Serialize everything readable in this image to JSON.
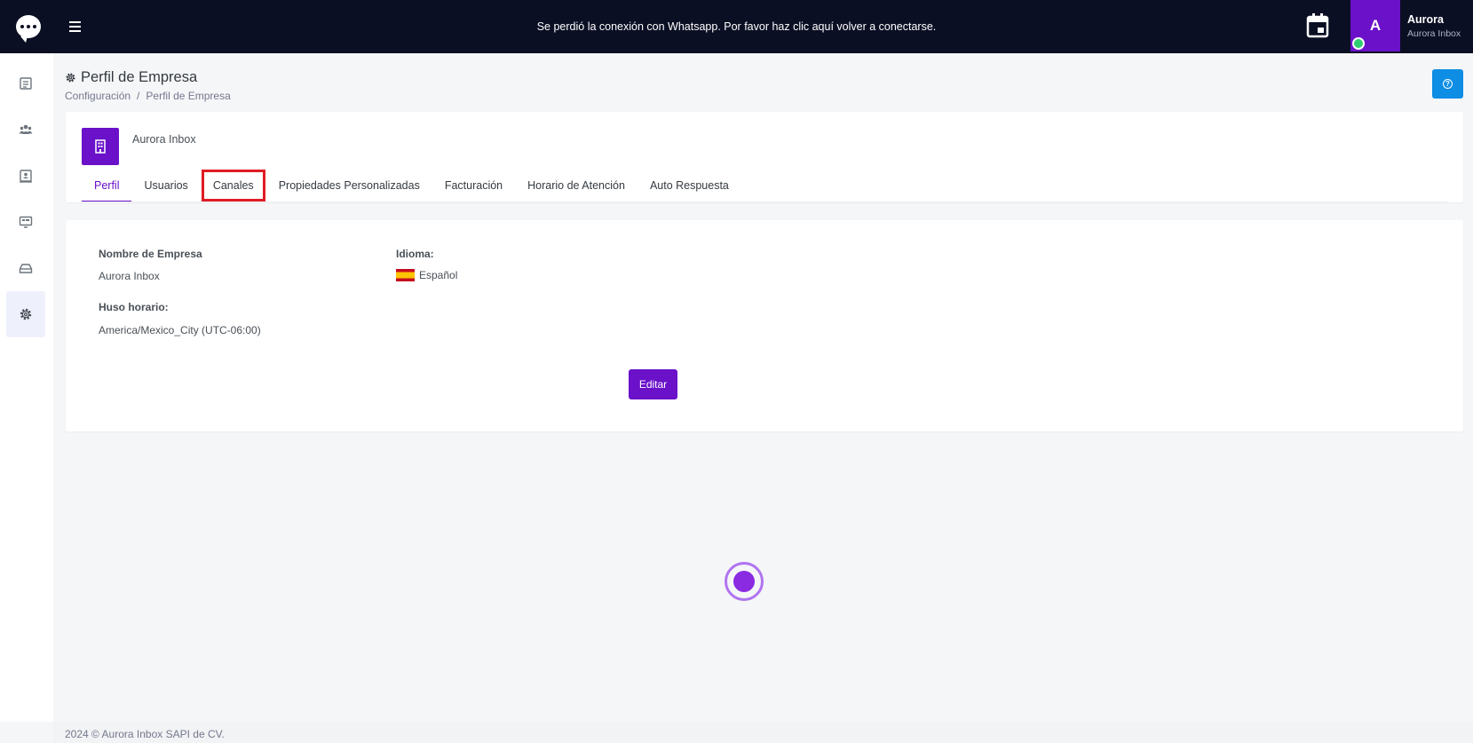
{
  "topbar": {
    "connection_message": "Se perdió la conexión con Whatsapp. Por favor haz clic aquí volver a conectarse.",
    "user": {
      "initial": "A",
      "name": "Aurora",
      "company": "Aurora Inbox",
      "status": "online",
      "status_color": "#2ecc71"
    },
    "icons": [
      "chat-logo-icon",
      "menu-icon",
      "calendar-icon"
    ]
  },
  "sidebar": {
    "items": [
      {
        "icon": "list-icon",
        "active": false
      },
      {
        "icon": "users-icon",
        "active": false
      },
      {
        "icon": "contacts-icon",
        "active": false
      },
      {
        "icon": "monitor-icon",
        "active": false
      },
      {
        "icon": "inbox-icon",
        "active": false
      },
      {
        "icon": "settings-icon",
        "active": true
      }
    ]
  },
  "page": {
    "title": "Perfil de Empresa",
    "breadcrumb": [
      "Configuración",
      "/",
      "Perfil de Empresa"
    ]
  },
  "company": {
    "name": "Aurora Inbox",
    "tabs": [
      {
        "label": "Perfil",
        "active": true
      },
      {
        "label": "Usuarios",
        "active": false
      },
      {
        "label": "Canales",
        "active": false,
        "highlighted": true
      },
      {
        "label": "Propiedades Personalizadas",
        "active": false
      },
      {
        "label": "Facturación",
        "active": false
      },
      {
        "label": "Horario de Atención",
        "active": false
      },
      {
        "label": "Auto Respuesta",
        "active": false
      }
    ]
  },
  "profile": {
    "company_name_label": "Nombre de Empresa",
    "company_name_value": "Aurora Inbox",
    "timezone_label": "Huso horario:",
    "timezone_value": "America/Mexico_City (UTC-06:00)",
    "language_label": "Idioma:",
    "language_value": "Español",
    "edit_button": "Editar"
  },
  "footer": {
    "text": "2024 © Aurora Inbox SAPI de CV."
  },
  "colors": {
    "topbar": "#0b0f24",
    "accent": "#6a11c9",
    "help_button": "#0d8de4",
    "highlight": "#e01b24"
  }
}
